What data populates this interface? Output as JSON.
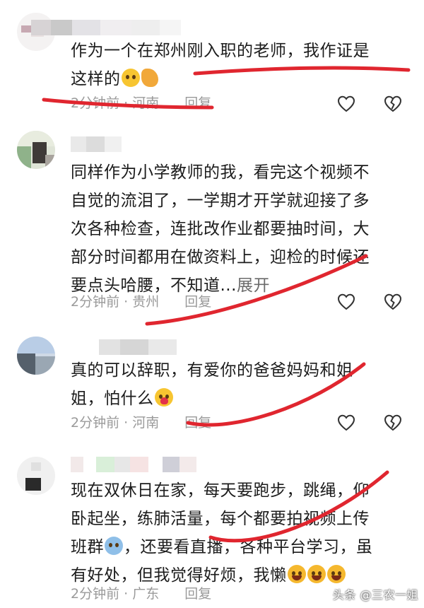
{
  "comments": [
    {
      "text_line1": "作为一个在郑州刚入职的老师，我作证是",
      "text_line2": "这样的",
      "emojis": [
        "face-holding-back-tears",
        "pointing-hand"
      ],
      "time": "2分钟前",
      "location": "河南",
      "reply": "回复"
    },
    {
      "text_lines": [
        "同样作为小学教师的我，看完这个视频不",
        "自觉的流泪了，一学期才开学就迎接了多",
        "次各种检查，连批改作业都要抽时间，大",
        "部分时间都用在做资料上，迎检的时候还"
      ],
      "text_last": "要点头哈腰，不知道...",
      "expand": "展开",
      "time": "2分钟前",
      "location": "贵州",
      "reply": "回复"
    },
    {
      "text_line1": "真的可以辞职，有爱你的爸爸妈妈和姐",
      "text_line2": "姐，怕什么",
      "emojis": [
        "smiling-face-with-hearts"
      ],
      "time": "2分钟前",
      "location": "河南",
      "reply": "回复"
    },
    {
      "text_line1": "现在双休日在家，每天要跑步，跳绳，仰",
      "text_line2": "卧起坐，练肺活量，每个都要拍视频上传",
      "text_line3a": "班群",
      "text_line3b": "，还要看直播，各种平台学习，虽",
      "text_line4": "有好处，但我觉得好烦，我懒",
      "emojis": [
        "tears-of-joy",
        "tears-of-joy",
        "tears-of-joy"
      ],
      "time": "2分钟前",
      "location": "广东",
      "reply": "回复"
    }
  ],
  "icons": {
    "like": "heart-outline-icon",
    "dislike": "broken-heart-outline-icon"
  },
  "colors": {
    "annotation_red": "#e0262f",
    "meta_gray": "#9a9a9a"
  },
  "watermark": "头条 @三农一姐"
}
